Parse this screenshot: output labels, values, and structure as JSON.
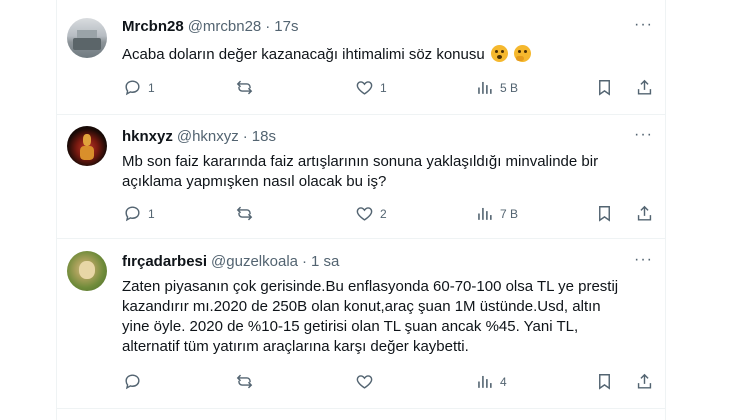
{
  "tweets": [
    {
      "name": "Mrcbn28",
      "handle": "@mrcbn28",
      "dot": "·",
      "time": "17s",
      "lines": [
        "Acaba doların değer kazanacağı ihtimalimi söz konusu"
      ],
      "emojis": [
        "hushed-face-emoji",
        "thinking-face-emoji"
      ],
      "more": "···",
      "replies": "1",
      "retweets": "",
      "likes": "1",
      "views": "5 B"
    },
    {
      "name": "hknxyz",
      "handle": "@hknxyz",
      "dot": "·",
      "time": "18s",
      "lines": [
        "Mb son faiz kararında faiz artışlarının sonuna yaklaşıldığı minvalinde bir",
        "açıklama yapmışken nasıl olacak bu iş?"
      ],
      "more": "···",
      "replies": "1",
      "retweets": "",
      "likes": "2",
      "views": "7 B"
    },
    {
      "name": "fırçadarbesi",
      "handle": "@guzelkoala",
      "dot": "·",
      "time": "1 sa",
      "lines": [
        "Zaten piyasanın çok gerisinde.Bu enflasyonda 60-70-100 olsa TL ye prestij",
        "kazandırır mı.2020 de 250B olan konut,araç şuan 1M üstünde.Usd, altın",
        "yine öyle. 2020 de %10-15 getirisi olan TL şuan ancak %45. Yani TL,",
        "alternatif tüm yatırım araçlarına karşı değer kaybetti."
      ],
      "more": "···",
      "replies": "",
      "retweets": "",
      "likes": "",
      "views": "4"
    }
  ],
  "colors": {
    "text": "#0f1419",
    "secondary": "#536471",
    "border": "#eff3f4"
  }
}
